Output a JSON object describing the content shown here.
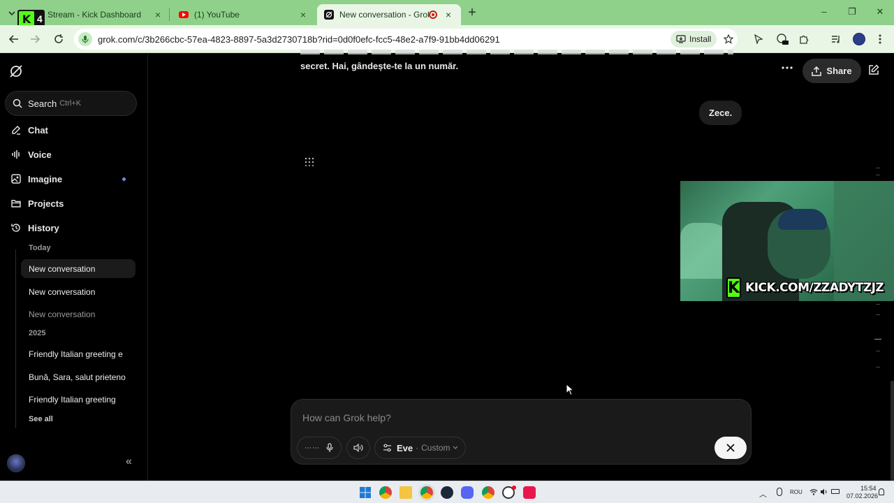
{
  "browser": {
    "tabs": [
      {
        "title": "Stream - Kick Dashboard",
        "close": "×"
      },
      {
        "title": "(1) YouTube",
        "close": "×"
      },
      {
        "title": "New conversation - Grok",
        "close": "×"
      }
    ],
    "new_tab": "+",
    "url": "grok.com/c/3b266cbc-57ea-4823-8897-5a3d2730718b?rid=0d0f0efc-fcc5-48e2-a7f9-91bb4dd06291",
    "install_label": "Install",
    "window_controls": {
      "minimize": "–",
      "restore": "❐",
      "close": "✕"
    }
  },
  "overlay": {
    "kick_badge_number": "4",
    "kick_banner_text": "KICK.COM/ZZADYTZJZ"
  },
  "sidebar": {
    "search_label": "Search",
    "search_shortcut": "Ctrl+K",
    "nav": [
      {
        "label": "Chat",
        "icon": "chat-edit-icon"
      },
      {
        "label": "Voice",
        "icon": "voice-wave-icon"
      },
      {
        "label": "Imagine",
        "icon": "image-icon"
      },
      {
        "label": "Projects",
        "icon": "folder-icon"
      },
      {
        "label": "History",
        "icon": "history-icon"
      }
    ],
    "history_sections": [
      {
        "heading": "Today",
        "items": [
          "New conversation",
          "New conversation",
          "New conversation"
        ]
      },
      {
        "heading": "2025",
        "items": [
          "Friendly Italian greeting e",
          "Bună, Sara, salut prieteno",
          "Friendly Italian greeting"
        ]
      }
    ],
    "see_all": "See all",
    "collapse_glyph": "«"
  },
  "main": {
    "assistant_fragment": "secret. Hai, gândește-te la un număr.",
    "user_message": "Zece.",
    "share_label": "Share",
    "composer_placeholder": "How can Grok help?",
    "voice_name": "Eve",
    "voice_separator": "·",
    "voice_mode": "Custom"
  },
  "taskbar": {
    "language": "ROU",
    "time": "15:54",
    "date": "07.02.2026"
  },
  "colors": {
    "tab_strip": "#8fd18a",
    "toolbar": "#e9f6e6",
    "app_background": "#000000",
    "kick_green": "#53fc18"
  }
}
